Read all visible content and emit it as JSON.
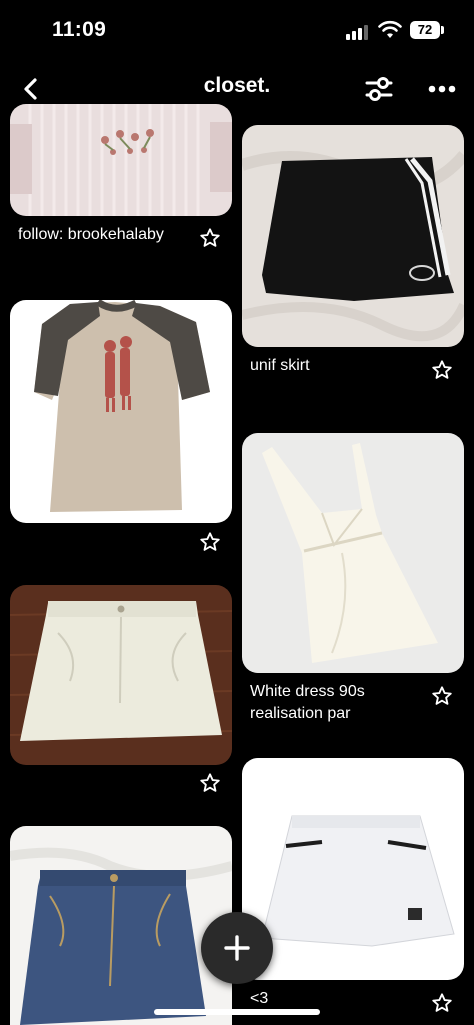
{
  "status_bar": {
    "time": "11:09",
    "battery": "72"
  },
  "header": {
    "title": "closet."
  },
  "pins": [
    {
      "caption": "follow: brookehalaby",
      "image": "pink knit sweater with embroidered flowers"
    },
    {
      "caption": "unif skirt",
      "image": "black skort with white side stripe"
    },
    {
      "caption": "",
      "image": "beige raglan tee with grey sleeves"
    },
    {
      "caption": "White dress 90s realisation par",
      "image": "white halter mini dress"
    },
    {
      "caption": "",
      "image": "white denim mini skirt"
    },
    {
      "caption": "<3",
      "image": "white tennis skirt"
    },
    {
      "caption": "",
      "image": "blue denim shorts"
    }
  ],
  "colors": {
    "background": "#000000",
    "text": "#ffffff",
    "fab": "#2a2a2a"
  },
  "icons": [
    "chevron-left-icon",
    "sliders-icon",
    "more-icon",
    "star-icon",
    "plus-icon"
  ]
}
